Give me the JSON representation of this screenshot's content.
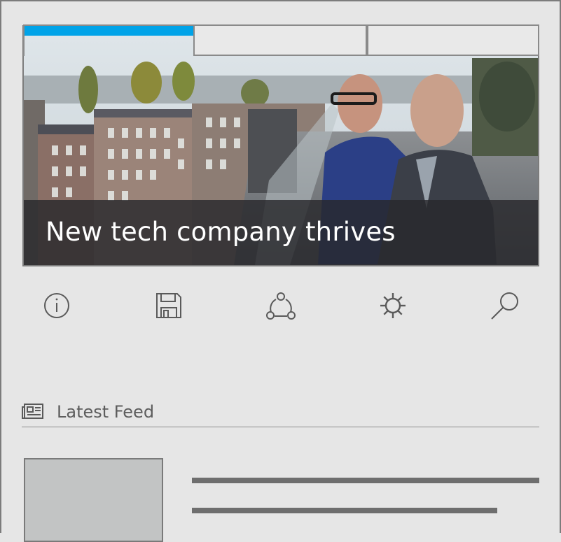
{
  "hero": {
    "caption": "New tech company thrives",
    "tabs": [
      {
        "name": "tab-1",
        "active": true
      },
      {
        "name": "tab-2",
        "active": false
      },
      {
        "name": "tab-3",
        "active": false
      }
    ],
    "accent_color": "#00a3e8"
  },
  "toolbar": {
    "icons": [
      "info-icon",
      "save-icon",
      "share-icon",
      "settings-icon",
      "search-icon"
    ]
  },
  "feed": {
    "title": "Latest Feed",
    "icon": "newspaper-icon"
  }
}
